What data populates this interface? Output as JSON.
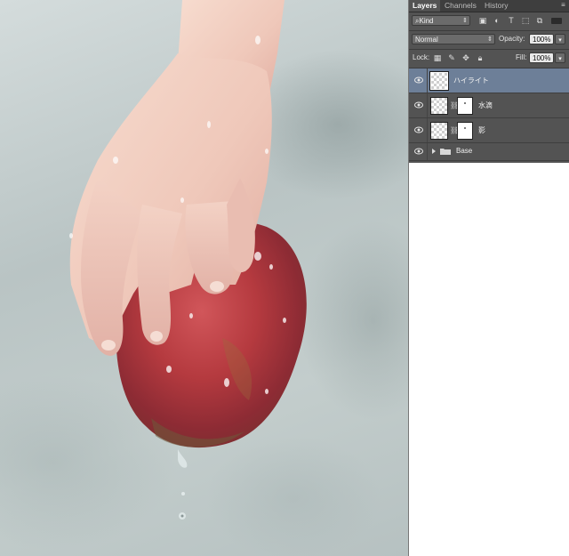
{
  "panel": {
    "tabs": [
      {
        "label": "Layers",
        "active": true
      },
      {
        "label": "Channels",
        "active": false
      },
      {
        "label": "History",
        "active": false
      }
    ],
    "filter": {
      "label": "Kind"
    },
    "blend_mode": "Normal",
    "opacity": {
      "label": "Opacity:",
      "value": "100%"
    },
    "lock": {
      "label": "Lock:"
    },
    "fill": {
      "label": "Fill:",
      "value": "100%"
    },
    "layers": [
      {
        "name": "ハイライト",
        "visible": true,
        "selected": true,
        "has_mask": false
      },
      {
        "name": "水滴",
        "visible": true,
        "selected": false,
        "has_mask": true
      },
      {
        "name": "影",
        "visible": true,
        "selected": false,
        "has_mask": true
      },
      {
        "name": "Base",
        "visible": true,
        "selected": false,
        "type": "group"
      }
    ],
    "colors": {
      "panel_bg": "#535353",
      "selected_row": "#6d7f98",
      "tab_bar": "#3e3e3e"
    }
  },
  "canvas": {
    "description_icon": "painting-hand-holding-apple",
    "colors": {
      "background": "#bcc6c6",
      "apple": "#b53a3f",
      "skin": "#f1cfc3"
    }
  }
}
